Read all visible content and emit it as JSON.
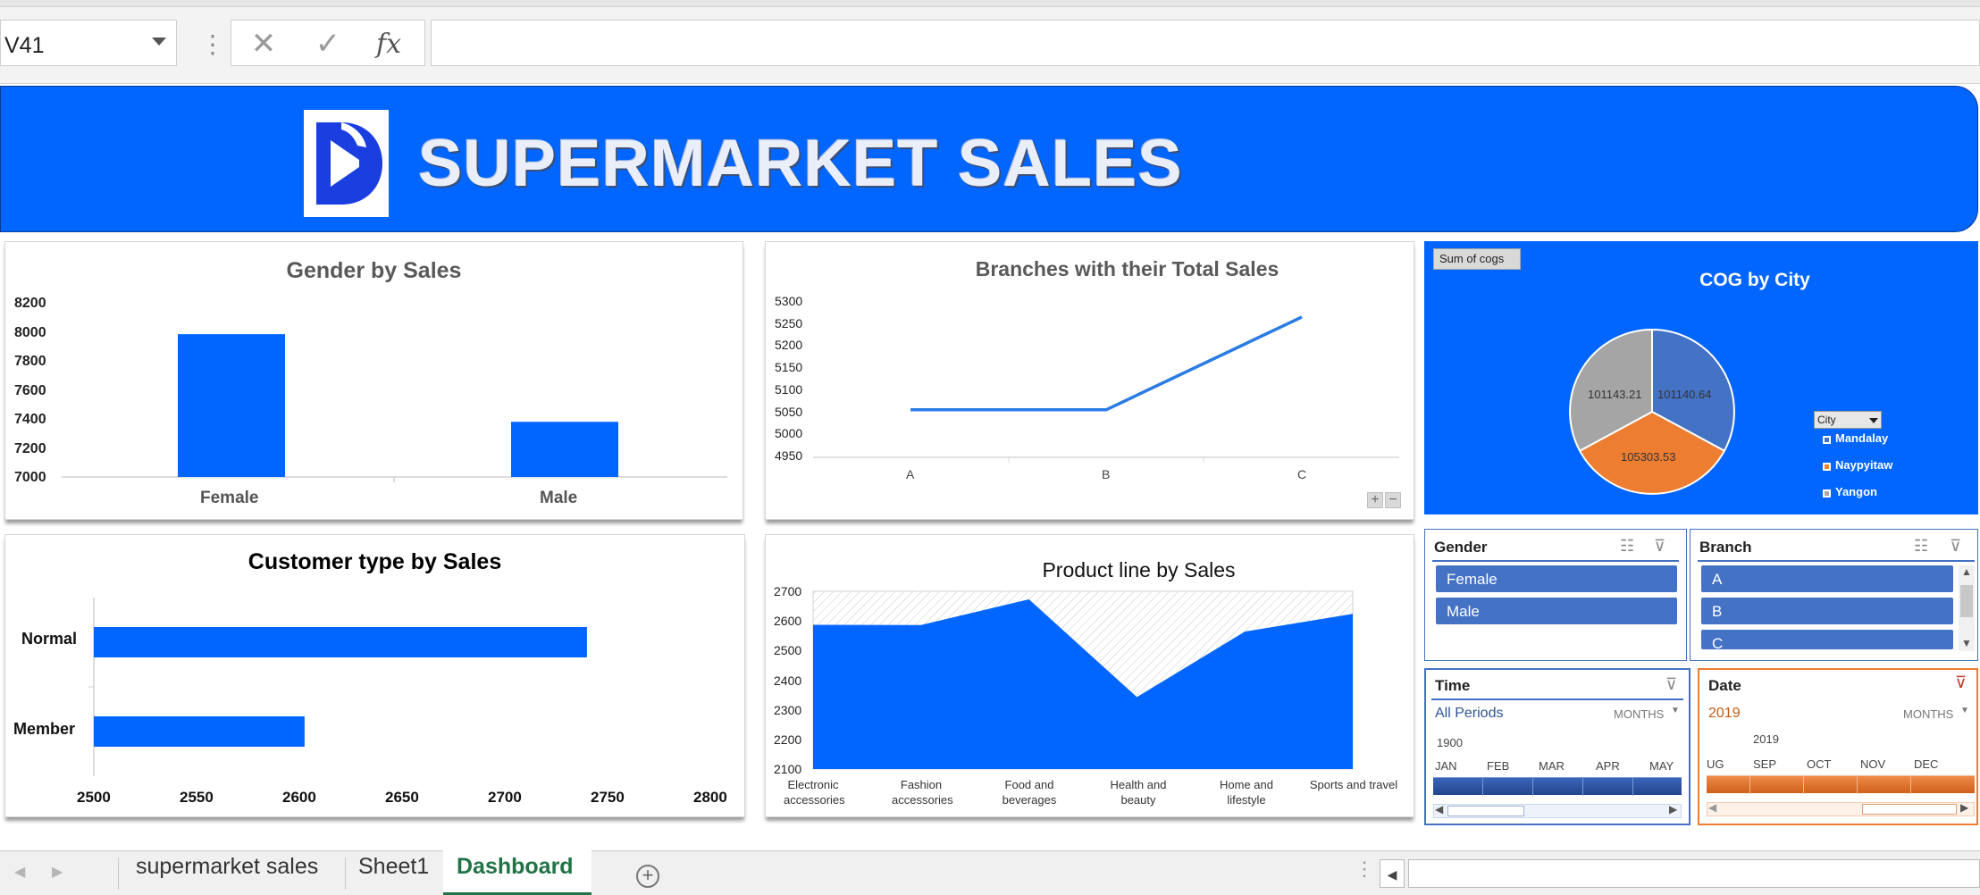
{
  "formula_bar": {
    "name_box": "V41",
    "cancel_icon": "close-icon",
    "enter_icon": "check-icon",
    "function_label": "fx",
    "formula_value": ""
  },
  "banner": {
    "title": "SUPERMARKET SALES",
    "logo_icon": "d-logo-icon",
    "color": "#0066ff"
  },
  "charts": {
    "gender": {
      "title": "Gender by Sales",
      "y_ticks": [
        "8200",
        "8000",
        "7800",
        "7600",
        "7400",
        "7200",
        "7000"
      ],
      "categories": [
        "Female",
        "Male"
      ]
    },
    "branches": {
      "title": "Branches with their Total Sales",
      "y_ticks": [
        "5300",
        "5250",
        "5200",
        "5150",
        "5100",
        "5050",
        "5000",
        "4950"
      ],
      "categories": [
        "A",
        "B",
        "C"
      ]
    },
    "cog": {
      "title": "COG by City",
      "field_button": "Sum of cogs",
      "labels": [
        "101140.64",
        "105303.53",
        "101143.21"
      ],
      "legend_filter": "City",
      "legend": [
        "Mandalay",
        "Naypyitaw",
        "Yangon"
      ]
    },
    "customer": {
      "title": "Customer type by Sales",
      "categories": [
        "Normal",
        "Member"
      ],
      "x_ticks": [
        "2500",
        "2550",
        "2600",
        "2650",
        "2700",
        "2750",
        "2800"
      ]
    },
    "product": {
      "title": "Product line by Sales",
      "y_ticks": [
        "2700",
        "2600",
        "2500",
        "2400",
        "2300",
        "2200",
        "2100"
      ],
      "categories": [
        [
          "Electronic",
          "accessories"
        ],
        [
          "Fashion",
          "accessories"
        ],
        [
          "Food and",
          "beverages"
        ],
        [
          "Health and",
          "beauty"
        ],
        [
          "Home and",
          "lifestyle"
        ],
        [
          "Sports and travel",
          ""
        ]
      ]
    }
  },
  "chart_data": [
    {
      "type": "bar",
      "title": "Gender by Sales",
      "categories": [
        "Female",
        "Male"
      ],
      "values": [
        7994,
        7384
      ],
      "ylim": [
        7000,
        8200
      ],
      "color": "#0066ff",
      "grid": false
    },
    {
      "type": "line",
      "title": "Branches with their Total Sales",
      "categories": [
        "A",
        "B",
        "C"
      ],
      "values": [
        5057,
        5057,
        5266
      ],
      "ylim": [
        4950,
        5300
      ],
      "color": "#2a7be4",
      "grid": false
    },
    {
      "type": "pie",
      "title": "COG by City",
      "categories": [
        "Mandalay",
        "Naypyitaw",
        "Yangon"
      ],
      "values": [
        101140.64,
        105303.53,
        101143.21
      ],
      "colors": [
        "#4472c4",
        "#ed7d31",
        "#a5a5a5"
      ],
      "legend": "right"
    },
    {
      "type": "bar",
      "orientation": "horizontal",
      "title": "Customer type by Sales",
      "categories": [
        "Normal",
        "Member"
      ],
      "values": [
        2741,
        2603
      ],
      "xlim": [
        2500,
        2800
      ],
      "color": "#0066ff",
      "grid": false
    },
    {
      "type": "area",
      "title": "Product line by Sales",
      "categories": [
        "Electronic accessories",
        "Fashion accessories",
        "Food and beverages",
        "Health and beauty",
        "Home and lifestyle",
        "Sports and travel"
      ],
      "values": [
        2587,
        2586,
        2673,
        2343,
        2564,
        2624
      ],
      "ylim": [
        2100,
        2700
      ],
      "color": "#0066ff",
      "grid": false
    }
  ],
  "slicers": {
    "gender": {
      "title": "Gender",
      "items": [
        "Female",
        "Male"
      ]
    },
    "branch": {
      "title": "Branch",
      "items": [
        "A",
        "B",
        "C"
      ]
    },
    "time": {
      "title": "Time",
      "period": "All Periods",
      "level": "MONTHS",
      "year": "1900",
      "months": [
        "JAN",
        "FEB",
        "MAR",
        "APR",
        "MAY"
      ]
    },
    "date": {
      "title": "Date",
      "period": "2019",
      "level": "MONTHS",
      "year": "2019",
      "months": [
        "UG",
        "SEP",
        "OCT",
        "NOV",
        "DEC"
      ]
    }
  },
  "sheet_tabs": {
    "tabs": [
      "supermarket sales",
      "Sheet1",
      "Dashboard"
    ],
    "active": "Dashboard"
  }
}
